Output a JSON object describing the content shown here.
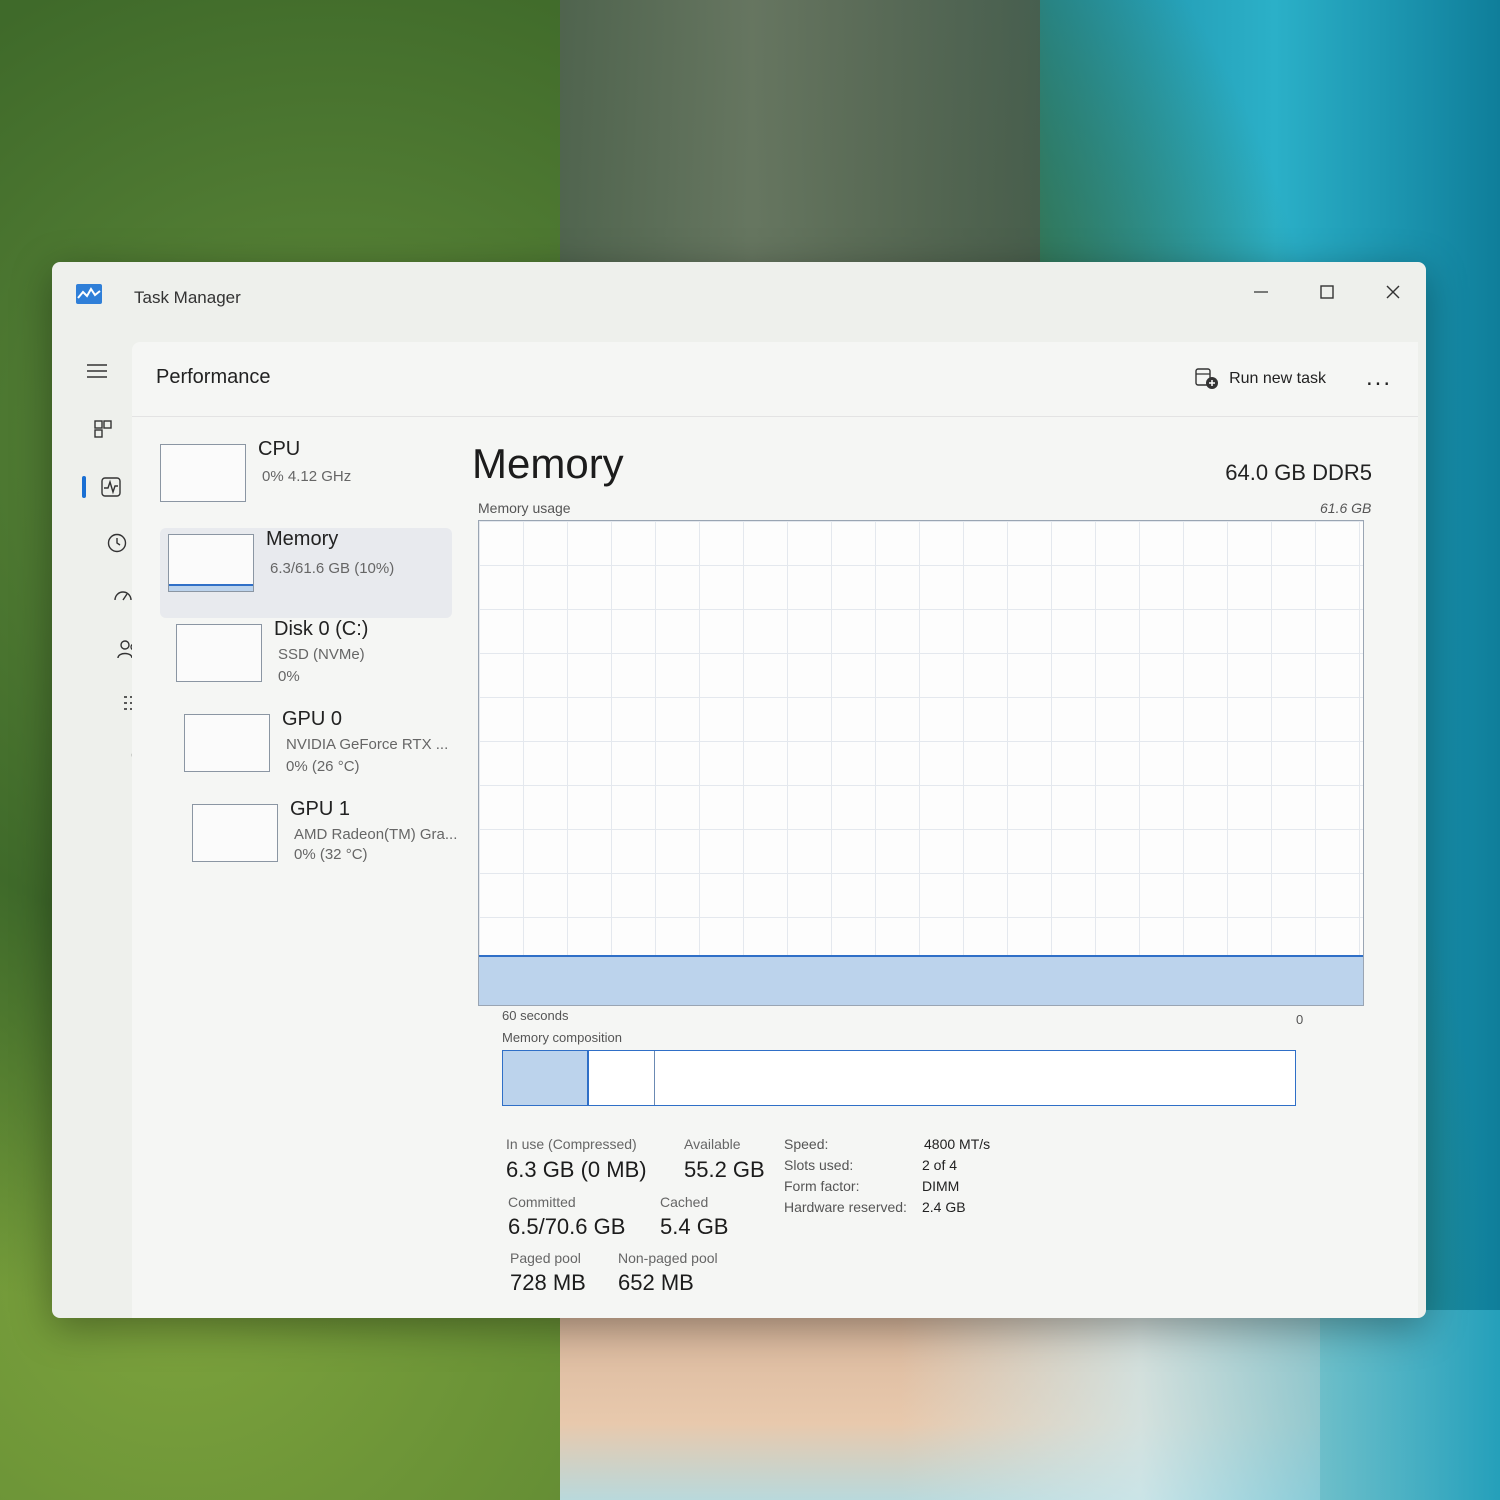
{
  "window": {
    "title": "Task Manager"
  },
  "header": {
    "page_title": "Performance",
    "run_new_task": "Run new task",
    "more": "..."
  },
  "nav": {
    "items": [
      "hamburger-icon",
      "processes-icon",
      "performance-icon",
      "app-history-icon",
      "startup-apps-icon",
      "users-icon",
      "details-icon",
      "services-icon"
    ],
    "active": "performance-icon"
  },
  "perf_items": [
    {
      "name": "CPU",
      "line1": "0%  4.12 GHz",
      "line2": ""
    },
    {
      "name": "Memory",
      "line1": "6.3/61.6 GB (10%)",
      "line2": ""
    },
    {
      "name": "Disk 0 (C:)",
      "line1": "SSD (NVMe)",
      "line2": "0%"
    },
    {
      "name": "GPU 0",
      "line1": "NVIDIA GeForce RTX ...",
      "line2": "0%  (26 °C)"
    },
    {
      "name": "GPU 1",
      "line1": "AMD Radeon(TM) Gra...",
      "line2": "0%  (32 °C)"
    }
  ],
  "memory": {
    "title": "Memory",
    "spec": "64.0 GB DDR5",
    "usage_label": "Memory usage",
    "usage_max": "61.6 GB",
    "time_left": "60 seconds",
    "time_right": "0",
    "composition_label": "Memory composition",
    "usage_fraction": 0.1,
    "stats": {
      "in_use_label": "In use (Compressed)",
      "in_use_value": "6.3 GB (0 MB)",
      "available_label": "Available",
      "available_value": "55.2 GB",
      "committed_label": "Committed",
      "committed_value": "6.5/70.6 GB",
      "cached_label": "Cached",
      "cached_value": "5.4 GB",
      "paged_label": "Paged pool",
      "paged_value": "728 MB",
      "nonpaged_label": "Non-paged pool",
      "nonpaged_value": "652 MB"
    },
    "details": [
      {
        "label": "Speed:",
        "value": "4800 MT/s"
      },
      {
        "label": "Slots used:",
        "value": "2 of 4"
      },
      {
        "label": "Form factor:",
        "value": "DIMM"
      },
      {
        "label": "Hardware reserved:",
        "value": "2.4 GB"
      }
    ]
  },
  "colors": {
    "accent": "#2f6fc7",
    "graph_fill": "#bcd3ec"
  }
}
